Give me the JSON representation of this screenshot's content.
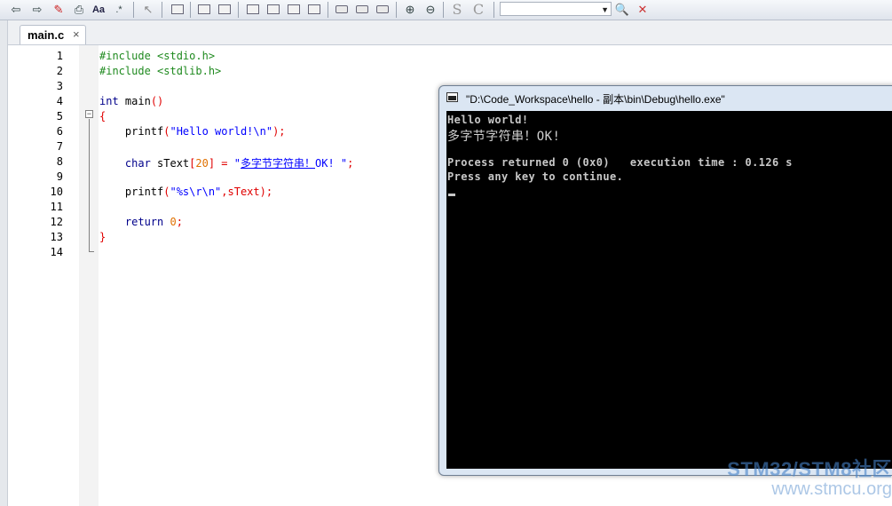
{
  "toolbar": {
    "icons": [
      "back-arrow-icon",
      "forward-arrow-icon",
      "highlighter-icon",
      "print-icon",
      "font-icon",
      "regex-icon",
      "pointer-icon",
      "rectangle-icon",
      "image-icon",
      "image2-icon",
      "bar-icon",
      "bar2-icon",
      "bar3-icon",
      "bar4-icon",
      "box-icon",
      "box2-icon",
      "box3-icon",
      "zoom-in-icon",
      "zoom-out-icon",
      "s-icon",
      "c-icon",
      "search-icon",
      "tools-icon"
    ],
    "combo_value": ""
  },
  "tabs": [
    {
      "label": "main.c",
      "close": "×"
    }
  ],
  "editor": {
    "lines": [
      "1",
      "2",
      "3",
      "4",
      "5",
      "6",
      "7",
      "8",
      "9",
      "10",
      "11",
      "12",
      "13",
      "14"
    ],
    "fold": "−",
    "code": {
      "l1": "#include <stdio.h>",
      "l2": "#include <stdlib.h>",
      "l4a": "int",
      "l4b": " main",
      "l4c": "()",
      "l5": "{",
      "l6a": "    printf",
      "l6b": "(",
      "l6c": "\"Hello world!\\n\"",
      "l6d": ");",
      "l8a": "    char",
      "l8b": " sText",
      "l8c": "[",
      "l8d": "20",
      "l8e": "]",
      "l8f": " = ",
      "l8g": "\"",
      "l8h": "多字节字符串！",
      "l8i": "OK! \"",
      "l8j": ";",
      "l10a": "    printf",
      "l10b": "(",
      "l10c": "\"%s\\r\\n\"",
      "l10d": ",sText);",
      "l12a": "    return",
      "l12b": " 0",
      "l12c": ";",
      "l13": "}"
    }
  },
  "console": {
    "title": "\"D:\\Code_Workspace\\hello - 副本\\bin\\Debug\\hello.exe\"",
    "lines": [
      "Hello world!",
      "多字节字符串！OK!",
      "",
      "Process returned 0 (0x0)   execution time : 0.126 s",
      "Press any key to continue."
    ]
  },
  "watermark": {
    "line1": "STM32/STM8社区",
    "line2": "www.stmcu.org"
  },
  "colors": {
    "preprocessor": "#1f8a1f",
    "keyword": "#00008b",
    "string": "#0000ff",
    "operator": "#e00000",
    "number": "#e07000"
  }
}
